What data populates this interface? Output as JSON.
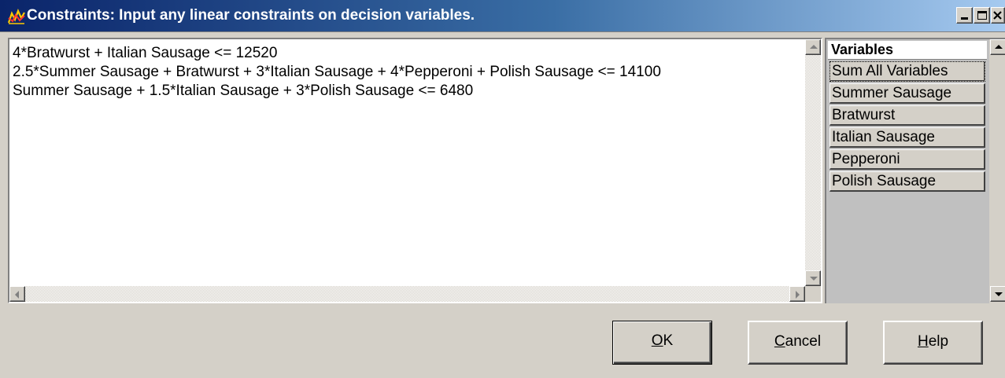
{
  "window": {
    "title": "Constraints: Input any linear constraints on decision variables.",
    "app_icon": "chart-lines-icon",
    "caption_buttons": [
      "minimize-icon",
      "maximize-icon",
      "close-icon"
    ]
  },
  "editor": {
    "lines": [
      "4*Bratwurst + Italian Sausage <= 12520",
      "2.5*Summer Sausage + Bratwurst + 3*Italian Sausage + 4*Pepperoni + Polish Sausage <= 14100",
      "Summer Sausage + 1.5*Italian Sausage + 3*Polish Sausage <= 6480"
    ]
  },
  "variables": {
    "header": "Variables",
    "items": [
      "Sum All Variables",
      "Summer Sausage",
      "Bratwurst",
      "Italian Sausage",
      "Pepperoni",
      "Polish Sausage"
    ]
  },
  "buttons": {
    "ok": {
      "mnemonic": "O",
      "rest": "K"
    },
    "cancel": {
      "mnemonic": "C",
      "rest": "ancel"
    },
    "help": {
      "mnemonic": "H",
      "rest": "elp"
    }
  },
  "colors": {
    "titlebar_start": "#0a246a",
    "titlebar_end": "#a6caf0",
    "face": "#d4d0c8"
  }
}
